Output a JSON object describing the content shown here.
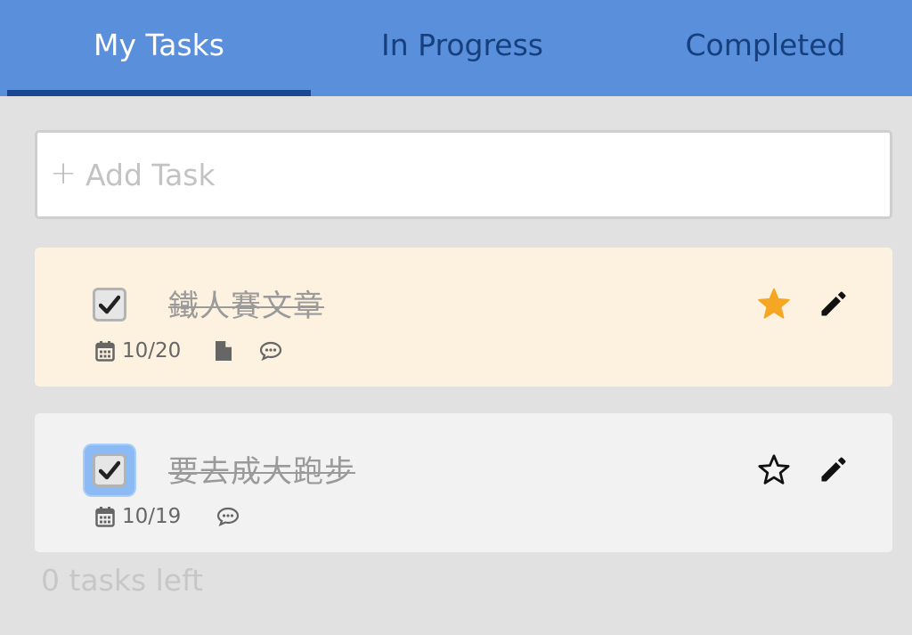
{
  "tabs": [
    {
      "label": "My Tasks",
      "active": true
    },
    {
      "label": "In Progress",
      "active": false
    },
    {
      "label": "Completed",
      "active": false
    }
  ],
  "add_task": {
    "plus": "+",
    "placeholder": "Add Task"
  },
  "tasks": [
    {
      "title": "鐵人賽文章",
      "completed": true,
      "starred": true,
      "date": "10/20",
      "has_file": true,
      "has_comment": true
    },
    {
      "title": "要去成大跑步",
      "completed": true,
      "starred": false,
      "date": "10/19",
      "has_file": false,
      "has_comment": true
    }
  ],
  "footer": {
    "tasks_left": "0 tasks left"
  },
  "colors": {
    "tabbar": "#5a8fdb",
    "active_tab_text": "#ffffff",
    "inactive_tab_text": "#163f7e",
    "underline": "#1b4692",
    "starred_bg": "#fdf1df",
    "star_fill": "#f5a623"
  },
  "icons": {
    "plus": "plus-icon",
    "calendar": "calendar-icon",
    "file": "file-icon",
    "comment": "comment-icon",
    "star_filled": "star-filled-icon",
    "star_outline": "star-outline-icon",
    "edit": "pencil-icon",
    "check": "checkmark-icon"
  }
}
